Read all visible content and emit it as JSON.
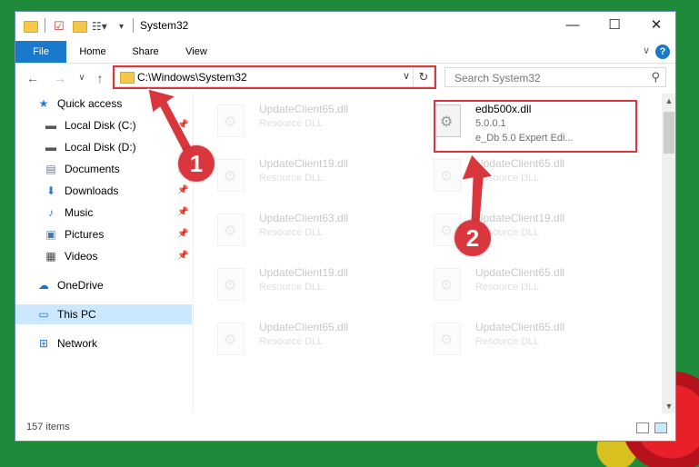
{
  "window": {
    "title": "System32",
    "controls": {
      "minimize": "—",
      "maximize": "☐",
      "close": "✕"
    }
  },
  "ribbon": {
    "tabs": [
      {
        "label": "File"
      },
      {
        "label": "Home"
      },
      {
        "label": "Share"
      },
      {
        "label": "View"
      }
    ],
    "help": "?"
  },
  "address": {
    "path": "C:\\Windows\\System32",
    "refresh_icon": "↻"
  },
  "search": {
    "placeholder": "Search System32"
  },
  "nav_pane": {
    "items": [
      {
        "label": "Quick access",
        "icon": "star-icon",
        "pinned": false
      },
      {
        "label": "Local Disk (C:)",
        "icon": "drive-icon",
        "pinned": true
      },
      {
        "label": "Local Disk (D:)",
        "icon": "drive-icon",
        "pinned": false
      },
      {
        "label": "Documents",
        "icon": "documents-icon",
        "pinned": true
      },
      {
        "label": "Downloads",
        "icon": "download-icon",
        "pinned": true
      },
      {
        "label": "Music",
        "icon": "music-icon",
        "pinned": true
      },
      {
        "label": "Pictures",
        "icon": "pictures-icon",
        "pinned": true
      },
      {
        "label": "Videos",
        "icon": "videos-icon",
        "pinned": true
      },
      {
        "label": "OneDrive",
        "icon": "cloud-icon",
        "pinned": false
      },
      {
        "label": "This PC",
        "icon": "computer-icon",
        "pinned": false,
        "selected": true
      },
      {
        "label": "Network",
        "icon": "network-icon",
        "pinned": false
      }
    ]
  },
  "files": {
    "left_column": [
      {
        "name": "UpdateClient65.dll",
        "type": "Resource DLL"
      },
      {
        "name": "UpdateClient19.dll",
        "type": "Resource DLL"
      },
      {
        "name": "UpdateClient63.dll",
        "type": "Resource DLL"
      },
      {
        "name": "UpdateClient19.dll",
        "type": "Resource DLL"
      },
      {
        "name": "UpdateClient65.dll",
        "type": "Resource DLL"
      }
    ],
    "highlighted": {
      "name": "edb500x.dll",
      "version": "5.0.0.1",
      "description": "e_Db 5.0 Expert Edi..."
    },
    "right_column": [
      {
        "name": "UpdateClient65.dll",
        "type": "Resource DLL"
      },
      {
        "name": "UpdateClient19.dll",
        "type": "Resource DLL"
      },
      {
        "name": "UpdateClient65.dll",
        "type": "Resource DLL"
      },
      {
        "name": "UpdateClient65.dll",
        "type": "Resource DLL"
      }
    ]
  },
  "status": {
    "item_count": "157 items"
  },
  "callouts": {
    "first": "1",
    "second": "2"
  },
  "colors": {
    "accent": "#1979ca",
    "highlight": "#d9363e",
    "selected": "#cce8ff"
  }
}
